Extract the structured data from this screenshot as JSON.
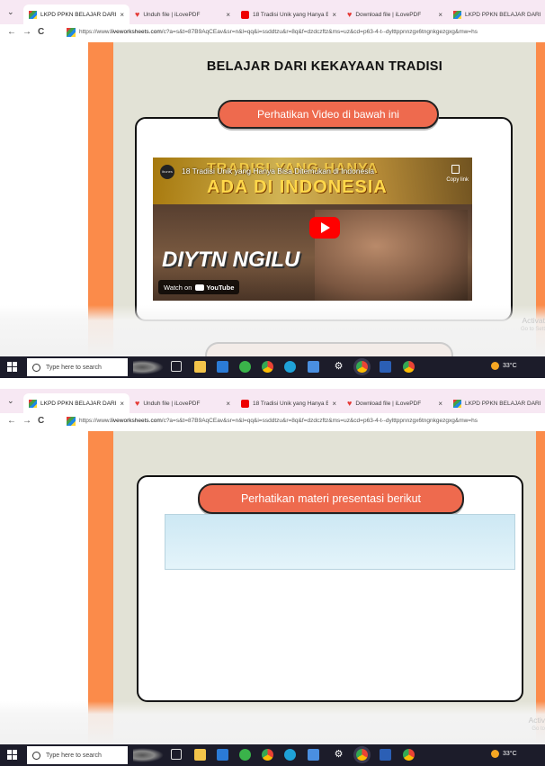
{
  "browser": {
    "tabs": [
      {
        "label": "LKPD PPKN BELAJAR DARI K",
        "favicon": "liveworksheets-icon",
        "active": true
      },
      {
        "label": "Unduh file | iLovePDF",
        "favicon": "ilovepdf-icon",
        "active": false
      },
      {
        "label": "18 Tradisi Unik yang Hanya B",
        "favicon": "youtube-icon",
        "active": false
      },
      {
        "label": "Download file | iLovePDF",
        "favicon": "ilovepdf-icon",
        "active": false
      },
      {
        "label": "LKPD PPKN BELAJAR DARI K",
        "favicon": "liveworksheets-icon",
        "active": false
      }
    ],
    "tab_close": "×",
    "nav": {
      "back": "←",
      "forward": "→",
      "reload": "C"
    },
    "url_prefix": "https://www.",
    "url_domain": "liveworksheets.com",
    "url_rest": "/c?a=s&t=87B9AqCEav&sr=n&l=qq&i=ssddtzu&r=8q&f=dzdczftz&ms=uz&cd=p63-4-t--dylttppnnzgx6tngnkgezgxg&mw=hs"
  },
  "screen1": {
    "headline": "BELAJAR DARI KEKAYAAN TRADISI",
    "pill_label": "Perhatikan Video di bawah ini",
    "video": {
      "channel_badge": "ibunes",
      "title": "18 Tradisi Unik yang Hanya Bisa Ditemukan di Indonesia",
      "copy_link": "Copy link",
      "thumb_text_top": "ADA DI INDONESIA",
      "thumb_text_top2": "TRADISI YANG HANYA",
      "thumb_text_bottom": "DIYTN NGILU",
      "watch_on": "Watch on",
      "youtube": "YouTube"
    },
    "activate_line1": "Activat",
    "activate_line2": "Go to Sett"
  },
  "screen2": {
    "pill_label": "Perhatikan materi presentasi berikut",
    "activate_line1": "Activ",
    "activate_line2": "Go to"
  },
  "taskbar": {
    "search_placeholder": "Type here to search",
    "temperature": "33°C",
    "icons": [
      "task-view-icon",
      "file-explorer-icon",
      "mail-icon",
      "whatsapp-icon",
      "chrome-icon",
      "edge-icon",
      "store-icon",
      "settings-icon",
      "chrome-icon",
      "word-icon",
      "chrome-icon"
    ]
  },
  "colors": {
    "orange_sidebar": "#fb8b4a",
    "pill_bg": "#ee6a4e",
    "page_bg": "#e2e2d6",
    "tabbar_bg": "#f7e8f3",
    "taskbar_bg": "#1c1c2a"
  }
}
